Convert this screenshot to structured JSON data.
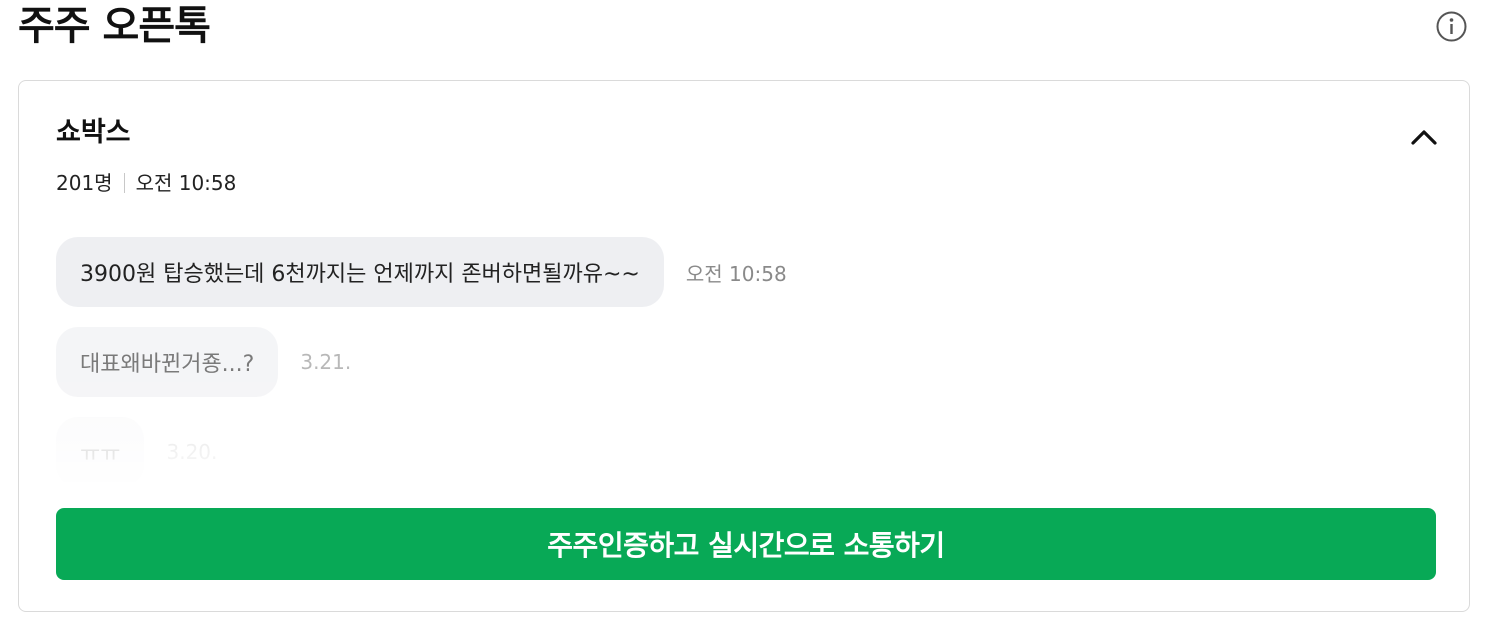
{
  "header": {
    "title": "주주 오픈톡",
    "info_icon": "info-circle-icon"
  },
  "room": {
    "name": "쇼박스",
    "member_count": "201명",
    "last_time": "오전 10:58",
    "collapse_icon": "chevron-up-icon"
  },
  "messages": [
    {
      "text": "3900원 탑승했는데 6천까지는 언제까지 존버하면될까유~~",
      "time": "오전 10:58"
    },
    {
      "text": "대표왜바뀐거죵...?",
      "time": "3.21."
    },
    {
      "text": "ㅠㅠ",
      "time": "3.20."
    }
  ],
  "cta": {
    "label": "주주인증하고 실시간으로 소통하기"
  },
  "colors": {
    "accent_green": "#08a956",
    "bubble_bg": "#eeeff2",
    "border": "#dadada"
  }
}
